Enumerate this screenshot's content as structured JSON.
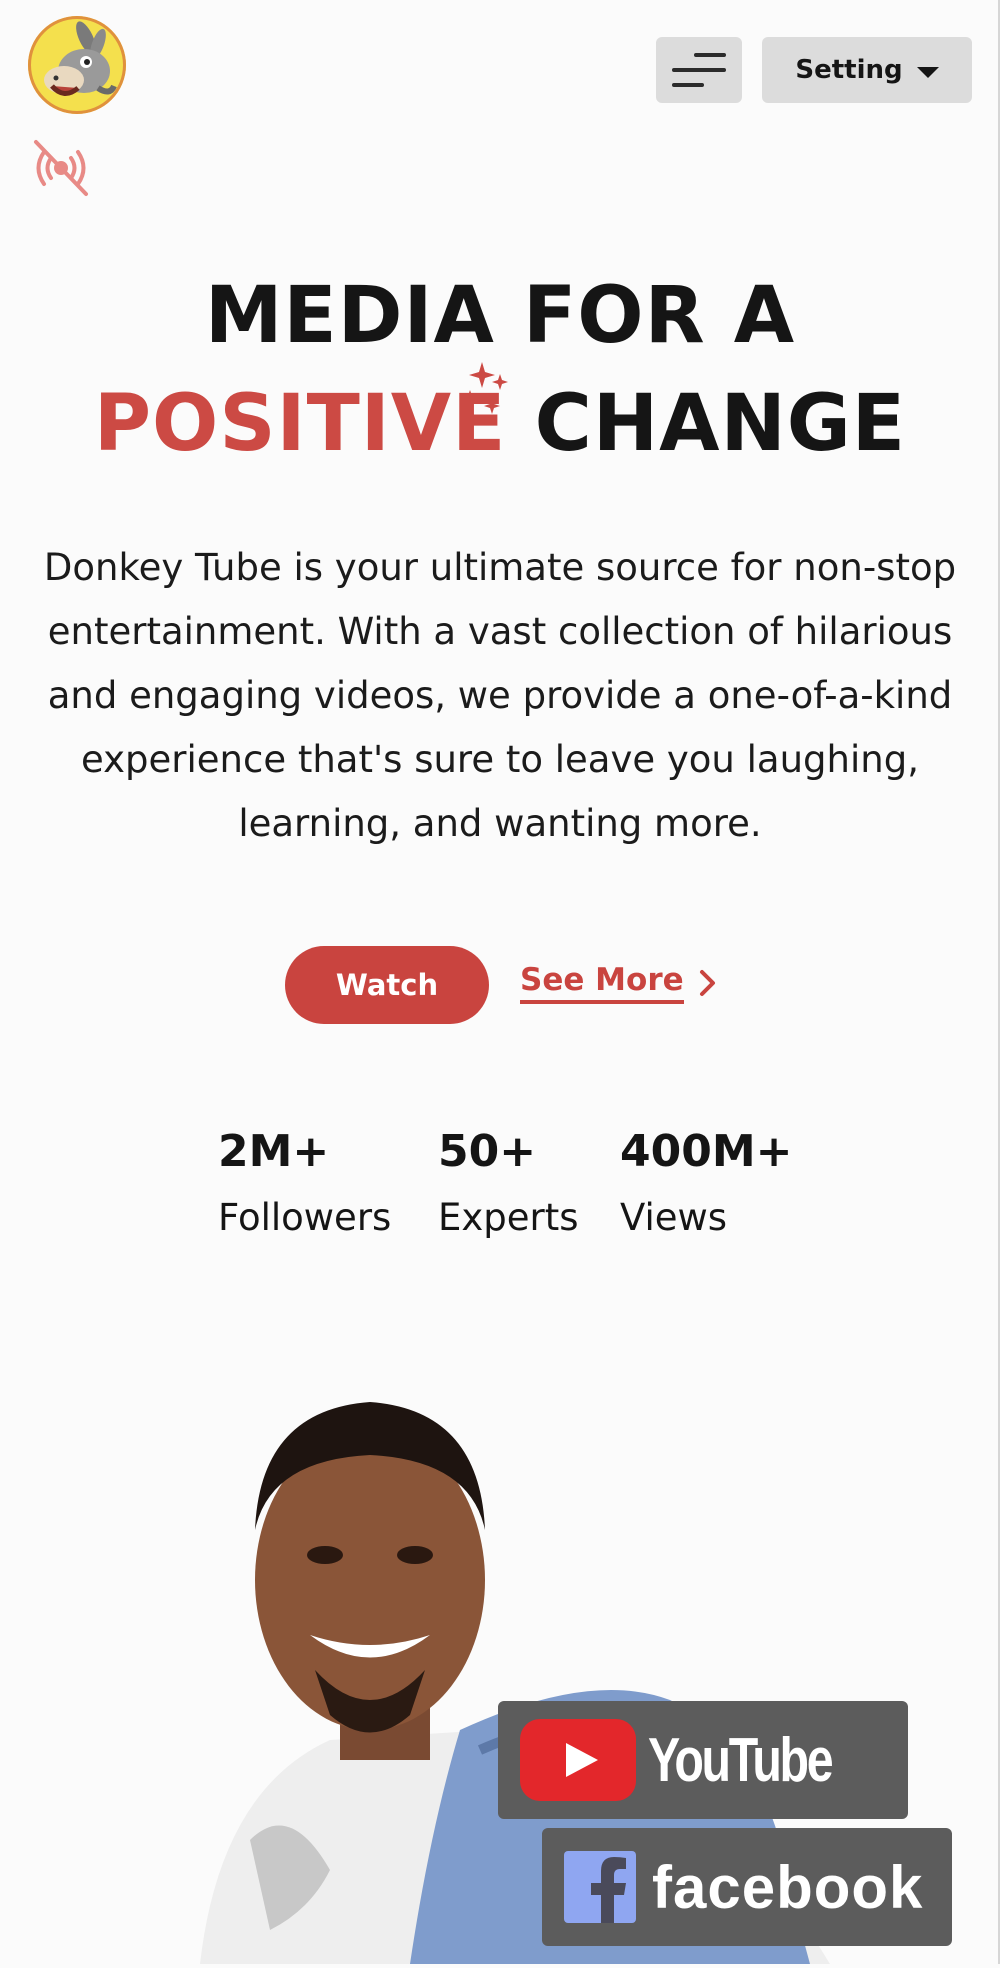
{
  "header": {
    "setting_label": "Setting"
  },
  "hero": {
    "title_line1": "MEDIA FOR A",
    "title_accent": "POSITIVE",
    "title_rest": "CHANGE",
    "description": "Donkey Tube is your ultimate source for non-stop entertainment. With a vast collection of hilarious and engaging videos, we provide a one-of-a-kind experience that's sure to leave you laughing, learning, and wanting more.",
    "watch_label": "Watch",
    "see_more_label": "See More"
  },
  "stats": [
    {
      "value": "2M+",
      "label": "Followers"
    },
    {
      "value": "50+",
      "label": "Experts"
    },
    {
      "value": "400M+",
      "label": "Views"
    }
  ],
  "badges": {
    "youtube_label": "YouTube",
    "facebook_label": "facebook"
  },
  "colors": {
    "accent": "#cc4a44",
    "button_bg": "#dcdcdc",
    "youtube_red": "#e3272b",
    "facebook_blue": "#8fa6f1"
  },
  "icons": {
    "logo": "donkey-logo-icon",
    "live": "live-off-icon",
    "menu": "hamburger-menu-icon",
    "setting_caret": "caret-down-icon",
    "see_more": "chevron-right-icon",
    "sparkle": "sparkle-icon",
    "youtube": "youtube-play-icon",
    "facebook": "facebook-f-icon"
  }
}
